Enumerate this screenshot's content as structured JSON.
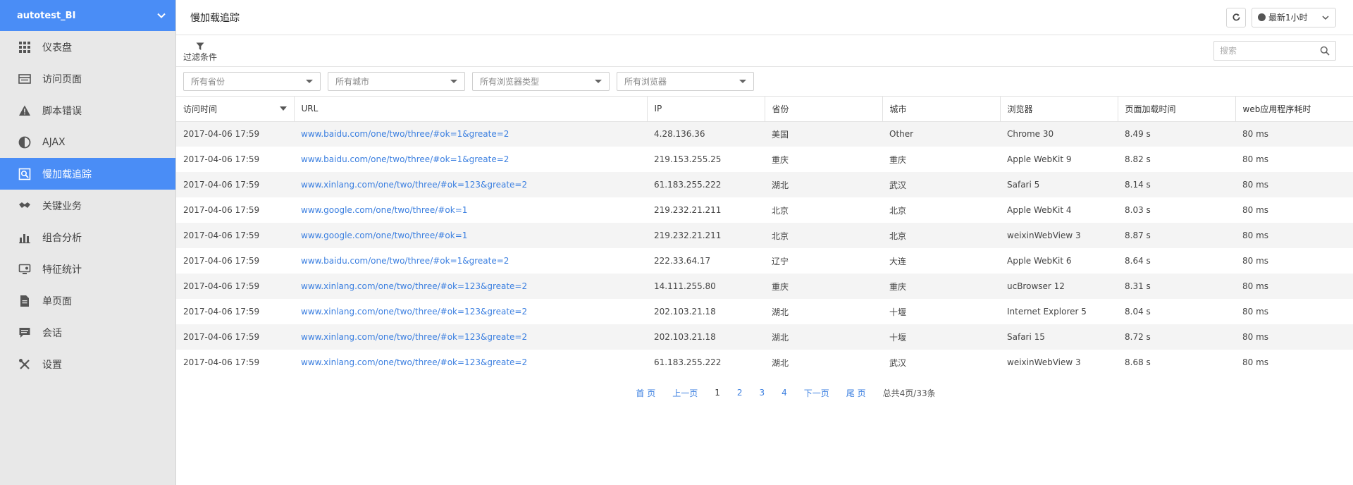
{
  "app": {
    "name": "autotest_BI"
  },
  "sidebar": {
    "items": [
      {
        "label": "仪表盘",
        "icon": "grid-icon"
      },
      {
        "label": "访问页面",
        "icon": "list-icon"
      },
      {
        "label": "脚本错误",
        "icon": "warning-icon"
      },
      {
        "label": "AJAX",
        "icon": "half-circle-icon"
      },
      {
        "label": "慢加载追踪",
        "icon": "search-page-icon"
      },
      {
        "label": "关键业务",
        "icon": "handshake-icon"
      },
      {
        "label": "组合分析",
        "icon": "bar-chart-icon"
      },
      {
        "label": "特征统计",
        "icon": "monitor-icon"
      },
      {
        "label": "单页面",
        "icon": "document-icon"
      },
      {
        "label": "会话",
        "icon": "chat-icon"
      },
      {
        "label": "设置",
        "icon": "tools-icon"
      }
    ],
    "active_index": 4
  },
  "header": {
    "title": "慢加载追踪",
    "time_range": "最新1小时"
  },
  "filter": {
    "label": "过滤条件",
    "search_placeholder": "搜索"
  },
  "selects": {
    "province": "所有省份",
    "city": "所有城市",
    "browser_type": "所有浏览器类型",
    "browser": "所有浏览器"
  },
  "table": {
    "columns": [
      "访问时间",
      "URL",
      "IP",
      "省份",
      "城市",
      "浏览器",
      "页面加载时间",
      "web应用程序耗时"
    ],
    "rows": [
      [
        "2017-04-06 17:59",
        "www.baidu.com/one/two/three/#ok=1&greate=2",
        "4.28.136.36",
        "美国",
        "Other",
        "Chrome 30",
        "8.49 s",
        "80 ms"
      ],
      [
        "2017-04-06 17:59",
        "www.baidu.com/one/two/three/#ok=1&greate=2",
        "219.153.255.25",
        "重庆",
        "重庆",
        "Apple WebKit 9",
        "8.82 s",
        "80 ms"
      ],
      [
        "2017-04-06 17:59",
        "www.xinlang.com/one/two/three/#ok=123&greate=2",
        "61.183.255.222",
        "湖北",
        "武汉",
        "Safari 5",
        "8.14 s",
        "80 ms"
      ],
      [
        "2017-04-06 17:59",
        "www.google.com/one/two/three/#ok=1",
        "219.232.21.211",
        "北京",
        "北京",
        "Apple WebKit 4",
        "8.03 s",
        "80 ms"
      ],
      [
        "2017-04-06 17:59",
        "www.google.com/one/two/three/#ok=1",
        "219.232.21.211",
        "北京",
        "北京",
        "weixinWebView 3",
        "8.87 s",
        "80 ms"
      ],
      [
        "2017-04-06 17:59",
        "www.baidu.com/one/two/three/#ok=1&greate=2",
        "222.33.64.17",
        "辽宁",
        "大连",
        "Apple WebKit 6",
        "8.64 s",
        "80 ms"
      ],
      [
        "2017-04-06 17:59",
        "www.xinlang.com/one/two/three/#ok=123&greate=2",
        "14.111.255.80",
        "重庆",
        "重庆",
        "ucBrowser 12",
        "8.31 s",
        "80 ms"
      ],
      [
        "2017-04-06 17:59",
        "www.xinlang.com/one/two/three/#ok=123&greate=2",
        "202.103.21.18",
        "湖北",
        "十堰",
        "Internet Explorer 5",
        "8.04 s",
        "80 ms"
      ],
      [
        "2017-04-06 17:59",
        "www.xinlang.com/one/two/three/#ok=123&greate=2",
        "202.103.21.18",
        "湖北",
        "十堰",
        "Safari 15",
        "8.72 s",
        "80 ms"
      ],
      [
        "2017-04-06 17:59",
        "www.xinlang.com/one/two/three/#ok=123&greate=2",
        "61.183.255.222",
        "湖北",
        "武汉",
        "weixinWebView 3",
        "8.68 s",
        "80 ms"
      ]
    ]
  },
  "pagination": {
    "first": "首 页",
    "prev": "上一页",
    "pages": [
      "1",
      "2",
      "3",
      "4"
    ],
    "current": "1",
    "next": "下一页",
    "last": "尾 页",
    "total": "总共4页/33条"
  },
  "colors": {
    "accent": "#4a8df6",
    "link": "#3b7fe0"
  }
}
